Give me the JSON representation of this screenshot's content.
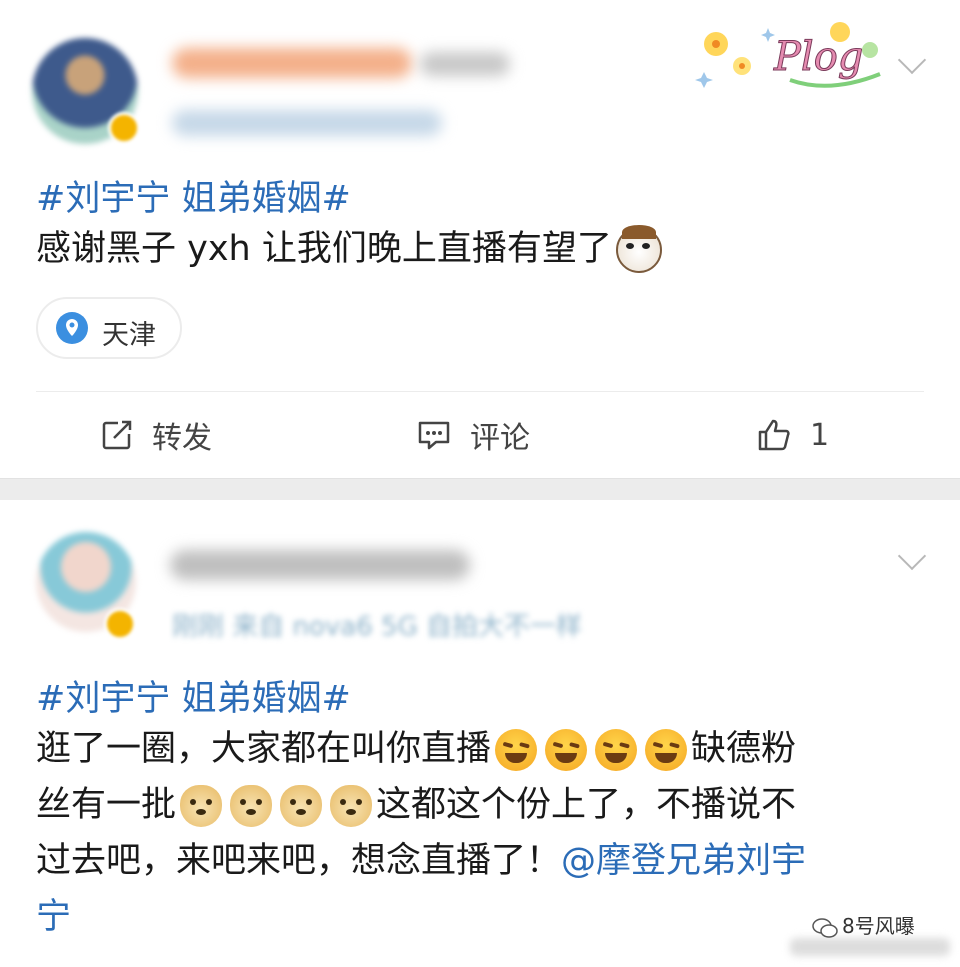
{
  "posts": [
    {
      "topic": "#刘宇宁 姐弟婚姻#",
      "text": "感谢黑子 yxh 让我们晚上直播有望了",
      "emoji_after": "cat-icon",
      "location": "天津",
      "actions": {
        "repost": "转发",
        "comment": "评论",
        "like_count": "1"
      },
      "sticker_text": "Plog"
    },
    {
      "meta": "刚刚  来自 nova6 5G 自拍大不一样",
      "topic": "#刘宇宁 姐弟婚姻#",
      "line1_a": "逛了一圈，大家都在叫你直播",
      "line1_b": "缺德粉",
      "line2_a": "丝有一批",
      "line2_b": "这都这个份上了，不播说不",
      "line3_a": "过去吧，来吧来吧，想念直播了！",
      "mention": "@摩登兄弟刘宇",
      "line4": "宁"
    }
  ],
  "watermark": "8号风曝",
  "colors": {
    "link": "#2b6cb7",
    "separator": "#ececec",
    "location_pin": "#3b8fe0"
  }
}
